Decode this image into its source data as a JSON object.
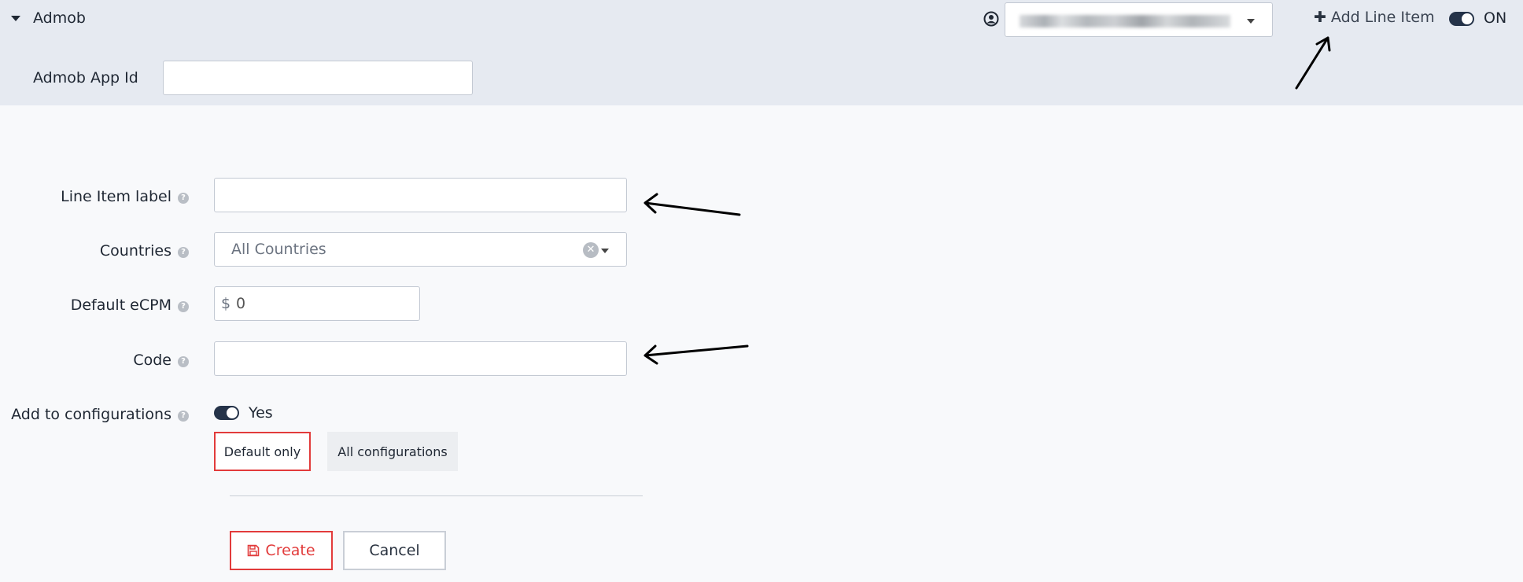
{
  "header": {
    "section_title": "Admob",
    "add_line_item": "Add Line Item",
    "toggle_state": "ON",
    "app_id_label": "Admob App Id",
    "app_id_value": ""
  },
  "form": {
    "line_item_label": "Line Item label",
    "line_item_value": "",
    "countries_label": "Countries",
    "countries_value": "All Countries",
    "ecpm_label": "Default eCPM",
    "ecpm_currency": "$",
    "ecpm_value": "0",
    "code_label": "Code",
    "code_value": "",
    "add_config_label": "Add to configurations",
    "add_config_toggle": "Yes",
    "config_default": "Default only",
    "config_all": "All configurations"
  },
  "actions": {
    "create": "Create",
    "cancel": "Cancel"
  },
  "colors": {
    "accent_red": "#e23b3b",
    "toggle_dark": "#253349",
    "header_bg": "#e6eaf1"
  }
}
